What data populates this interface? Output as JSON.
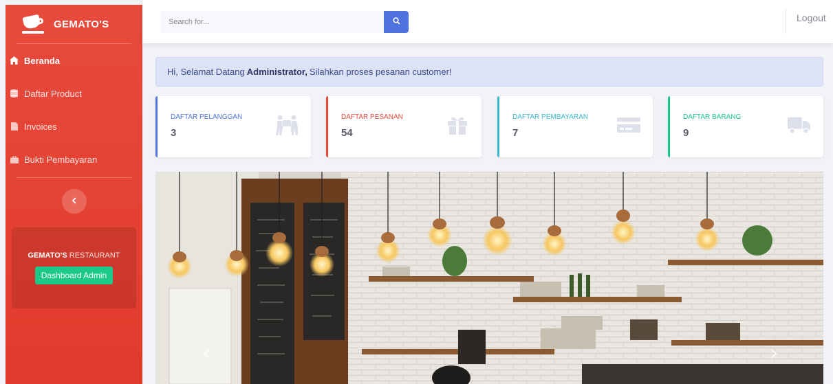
{
  "brand": {
    "name": "GEMATO'S",
    "icon": "coffee-cup-icon"
  },
  "sidebar": {
    "items": [
      {
        "label": "Beranda",
        "icon": "home-icon",
        "active": true
      },
      {
        "label": "Daftar Product",
        "icon": "database-icon",
        "active": false
      },
      {
        "label": "Invoices",
        "icon": "file-icon",
        "active": false
      },
      {
        "label": "Bukti Pembayaran",
        "icon": "briefcase-icon",
        "active": false
      }
    ],
    "toggle_icon": "chevron-left-icon",
    "promo": {
      "title_bold": "GEMATO'S",
      "title_rest": " RESTAURANT",
      "button": "Dashboard Admin"
    }
  },
  "topbar": {
    "search": {
      "placeholder": "Search for...",
      "value": ""
    },
    "logout": "Logout"
  },
  "welcome": {
    "prefix": "Hi, Selamat Datang",
    "user": "Administrator,",
    "suffix": "Silahkan proses pesanan customer!"
  },
  "cards": [
    {
      "label": "DAFTAR PELANGGAN",
      "value": "3",
      "icon": "people-carry-icon",
      "color": "#4e73df"
    },
    {
      "label": "DAFTAR PESANAN",
      "value": "54",
      "icon": "gift-icon",
      "color": "#e74a3b"
    },
    {
      "label": "DAFTAR PEMBAYARAN",
      "value": "7",
      "icon": "credit-card-icon",
      "color": "#36b9cc"
    },
    {
      "label": "DAFTAR BARANG",
      "value": "9",
      "icon": "truck-icon",
      "color": "#1cc88a"
    }
  ],
  "colors": {
    "primary": "#4e73df",
    "danger": "#e74a3b",
    "info": "#36b9cc",
    "success": "#1cc88a"
  }
}
